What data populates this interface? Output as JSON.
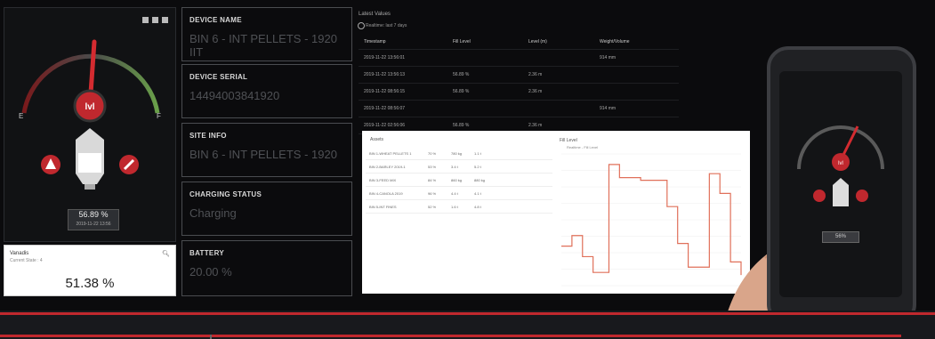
{
  "gauge": {
    "brand": "lvl",
    "scale_empty": "E",
    "scale_full": "F",
    "reading_value": "56.89 %",
    "reading_timestamp": "2019-11-22 13:56",
    "alert_icon": "warning-icon",
    "settings_icon": "wrench-icon"
  },
  "fill_card": {
    "title": "Vanadis",
    "subtitle": "Current State : 4",
    "value": "51.38 %",
    "search_icon": "search-icon"
  },
  "device": {
    "name_label": "DEVICE NAME",
    "name_value": "BIN 6 - INT PELLETS - 1920 IIT",
    "serial_label": "DEVICE SERIAL",
    "serial_value": "14494003841920",
    "site_label": "SITE INFO",
    "site_value": "BIN 6 - INT PELLETS - 1920",
    "charging_label": "CHARGING STATUS",
    "charging_value": "Charging",
    "battery_label": "BATTERY",
    "battery_value": "20.00 %"
  },
  "table": {
    "title": "Latest Values",
    "subtitle": "Realtime: last 7 days",
    "columns": [
      "Timestamp",
      "Fill Level",
      "Level (m)",
      "Weight/Volume"
    ],
    "rows": [
      [
        "2019-11-22 13:56:01",
        "",
        "",
        "914 mm"
      ],
      [
        "2019-11-22 13:56:13",
        "56.89 %",
        "2.36 m",
        ""
      ],
      [
        "2019-11-22 08:56:15",
        "56.89 %",
        "2.36 m",
        ""
      ],
      [
        "2019-11-22 08:56:07",
        "",
        "",
        "914 mm"
      ],
      [
        "2019-11-22 02:56:06",
        "56.89 %",
        "2.36 m",
        ""
      ]
    ]
  },
  "history": {
    "title": "Assets",
    "rows": [
      [
        "BIN 1-WHEAT PELLETS 1",
        "70 %",
        "780 kg",
        "1.1 t",
        ""
      ],
      [
        "BIN 2-BARLEY 2019-1",
        "53 %",
        "3.4 t",
        "5.2 t",
        ""
      ],
      [
        "BIN 3-FEED MIX",
        "84 %",
        "860 kg",
        "880 kg",
        ""
      ],
      [
        "BIN 4-CANOLA 2019",
        "96 %",
        "4.4 t",
        "4.1 t",
        ""
      ],
      [
        "BIN 5-INT FINES",
        "52 %",
        "1.6 t",
        "4.8 t",
        ""
      ]
    ],
    "chart_title": "Fill Level",
    "chart_legend": "Realtime - Fill Level"
  },
  "phone": {
    "value": "56%",
    "brand": "lvl"
  },
  "colors": {
    "accent_red": "#c0282e",
    "panel_bg": "#111214",
    "value_grey": "#4f5155"
  },
  "chart_data": {
    "type": "line",
    "title": "Fill Level",
    "series": [
      {
        "name": "Realtime - Fill Level",
        "values": [
          30,
          30,
          38,
          38,
          22,
          22,
          10,
          10,
          10,
          92,
          92,
          82,
          82,
          82,
          82,
          80,
          80,
          80,
          80,
          80,
          60,
          60,
          32,
          32,
          14,
          14,
          14,
          14,
          85,
          85,
          70,
          70,
          18,
          18,
          8
        ]
      }
    ],
    "ylim": [
      0,
      100
    ]
  }
}
